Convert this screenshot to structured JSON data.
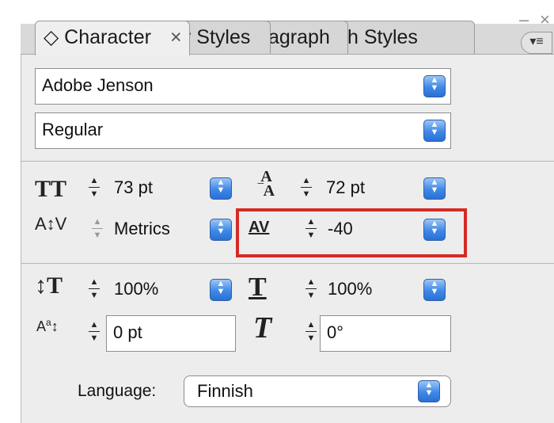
{
  "window": {
    "minimize_glyph": "–",
    "close_glyph": "×"
  },
  "tabs": [
    {
      "label": "◇ Character",
      "close": "×"
    },
    {
      "label": "r Styles"
    },
    {
      "label": "agraph"
    },
    {
      "label": "h Styles"
    }
  ],
  "flyout_glyph": "▾≡",
  "font": {
    "family": "Adobe Jenson",
    "style": "Regular"
  },
  "row1": {
    "size": "73 pt",
    "leading": "72 pt"
  },
  "row2": {
    "kerning": "Metrics",
    "tracking": "-40"
  },
  "row3": {
    "vertical_scale": "100%",
    "horizontal_scale": "100%"
  },
  "row4": {
    "baseline_shift": "0 pt",
    "skew": "0°"
  },
  "language": {
    "label": "Language:",
    "value": "Finnish"
  },
  "colors": {
    "highlight": "#d42b25",
    "popup_blue": "#3f88e6"
  }
}
